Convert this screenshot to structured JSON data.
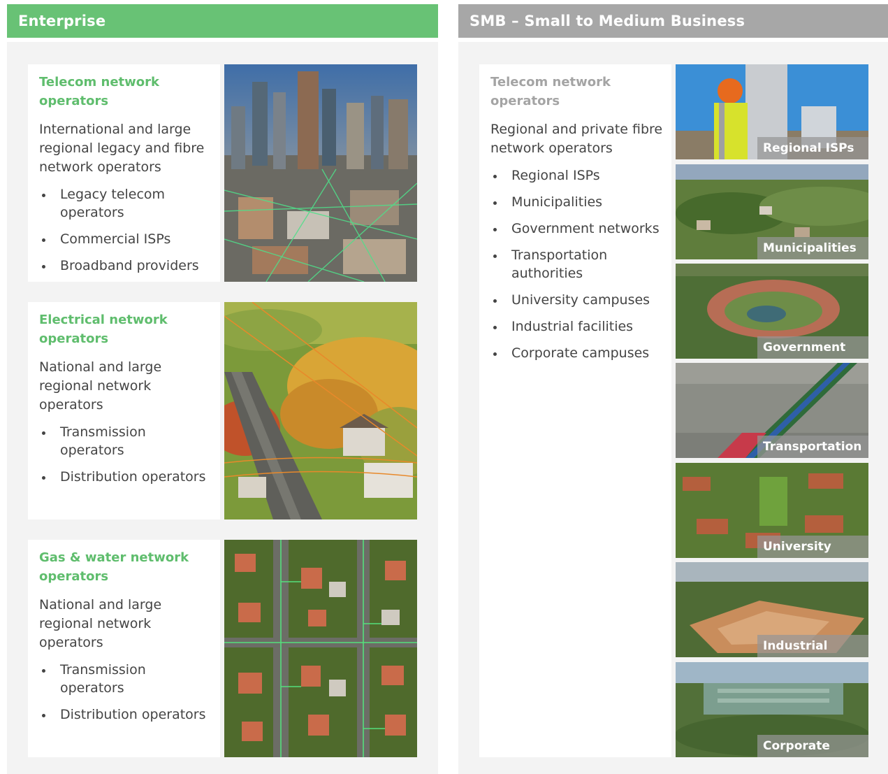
{
  "enterprise": {
    "header": "Enterprise",
    "cards": [
      {
        "title": "Telecom network operators",
        "description": "International and large regional legacy and fibre network operators",
        "bullets": [
          "Legacy telecom operators",
          "Commercial ISPs",
          "Broadband providers"
        ]
      },
      {
        "title": "Electrical network operators",
        "description": "National and large regional network operators",
        "bullets": [
          "Transmission operators",
          "Distribution operators"
        ]
      },
      {
        "title": "Gas & water network operators",
        "description": "National and large regional network operators",
        "bullets": [
          "Transmission operators",
          "Distribution operators"
        ]
      }
    ]
  },
  "smb": {
    "header": "SMB – Small to Medium Business",
    "card": {
      "title": "Telecom network operators",
      "description": "Regional and private fibre network operators",
      "bullets": [
        "Regional ISPs",
        "Municipalities",
        "Government networks",
        "Transportation authorities",
        "University campuses",
        "Industrial facilities",
        "Corporate campuses"
      ]
    },
    "thumbnails": [
      "Regional ISPs",
      "Municipalities",
      "Government",
      "Transportation",
      "University",
      "Industrial",
      "Corporate"
    ]
  },
  "colors": {
    "enterprise_accent": "#68c275",
    "smb_accent": "#a7a7a7",
    "panel_bg": "#f3f3f3"
  }
}
